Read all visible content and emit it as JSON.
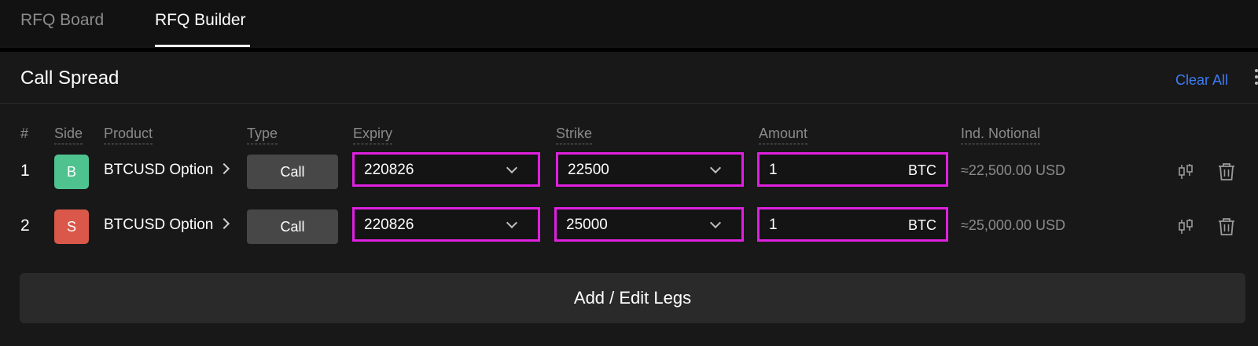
{
  "tabs": [
    {
      "label": "RFQ Board",
      "active": false
    },
    {
      "label": "RFQ Builder",
      "active": true
    }
  ],
  "panel": {
    "title": "Call Spread",
    "clear_all_label": "Clear All"
  },
  "columns": {
    "index": "#",
    "side": "Side",
    "product": "Product",
    "type": "Type",
    "expiry": "Expiry",
    "strike": "Strike",
    "amount": "Amount",
    "notional": "Ind. Notional"
  },
  "legs": [
    {
      "index": "1",
      "side": "B",
      "side_color": "#4fc38f",
      "product": "BTCUSD Option",
      "type": "Call",
      "expiry": "220826",
      "strike": "22500",
      "amount": "1",
      "amount_unit": "BTC",
      "notional": "≈22,500.00 USD"
    },
    {
      "index": "2",
      "side": "S",
      "side_color": "#d9584a",
      "product": "BTCUSD Option",
      "type": "Call",
      "expiry": "220826",
      "strike": "25000",
      "amount": "1",
      "amount_unit": "BTC",
      "notional": "≈25,000.00 USD"
    }
  ],
  "add_edit_label": "Add / Edit Legs",
  "colors": {
    "accent": "#3d7cf5",
    "highlight_border": "#e020e0",
    "buy": "#4fc38f",
    "sell": "#d9584a"
  },
  "icons": {
    "row_action_1": "candlestick-chart-icon",
    "row_action_2": "trash-icon"
  }
}
